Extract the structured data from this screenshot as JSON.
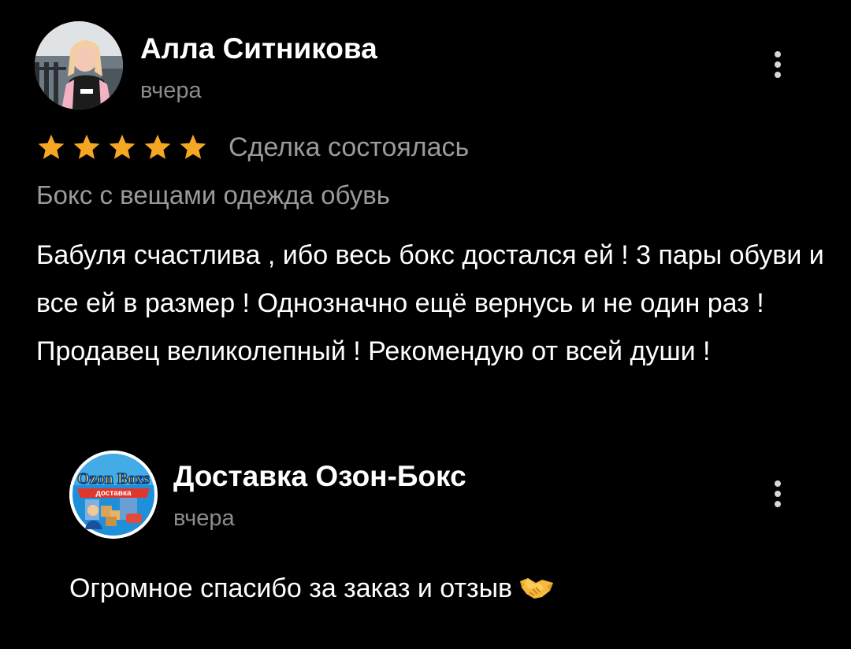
{
  "review": {
    "author_name": "Алла Ситникова",
    "date": "вчера",
    "rating": 5,
    "rating_max": 5,
    "deal_status": "Сделка состоялась",
    "product_name": "Бокс с вещами одежда обувь",
    "text": "Бабуля счастлива , ибо весь бокс достался ей ! 3 пары обуви и все ей в размер ! Однозначно ещё вернусь и не один раз ! Продавец великолепный ! Рекомендую от всей души !",
    "avatar_icon": "user-photo-avatar",
    "menu_icon": "more-vertical-icon"
  },
  "reply": {
    "author_name": "Доставка Озон-Бокс",
    "date": "вчера",
    "text": "Огромное спасибо за заказ и отзыв",
    "emoji_icon": "handshake-icon",
    "avatar_icon": "shop-logo-avatar",
    "logo_text_main": "Ozon Boxs",
    "logo_text_ribbon": "доставка",
    "menu_icon": "more-vertical-icon"
  },
  "colors": {
    "background": "#000000",
    "text_primary": "#ffffff",
    "text_secondary": "#8c8c8c",
    "star": "#f5a623"
  }
}
